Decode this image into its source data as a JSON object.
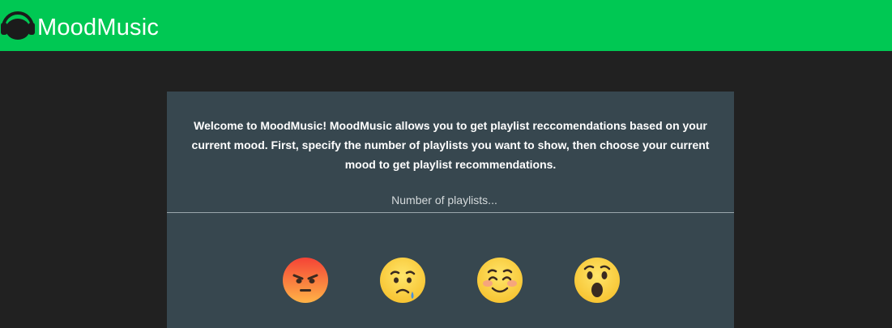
{
  "header": {
    "brand": "MoodMusic",
    "logo_icon": "headphones-icon",
    "bg_color": "#00c853"
  },
  "intro": {
    "text": "Welcome to MoodMusic! MoodMusic allows you to get playlist reccomendations based on your current mood. First, specify the number of playlists you want to show, then choose your current mood to get playlist recommendations."
  },
  "playlist_count": {
    "placeholder": "Number of playlists...",
    "value": ""
  },
  "moods": [
    {
      "name": "angry",
      "icon": "angry-face-icon"
    },
    {
      "name": "sad",
      "icon": "sad-face-icon"
    },
    {
      "name": "happy",
      "icon": "happy-face-icon"
    },
    {
      "name": "surprised",
      "icon": "surprised-face-icon"
    }
  ],
  "colors": {
    "page_bg": "#212121",
    "panel_bg": "#37474f",
    "accent": "#00c853"
  }
}
